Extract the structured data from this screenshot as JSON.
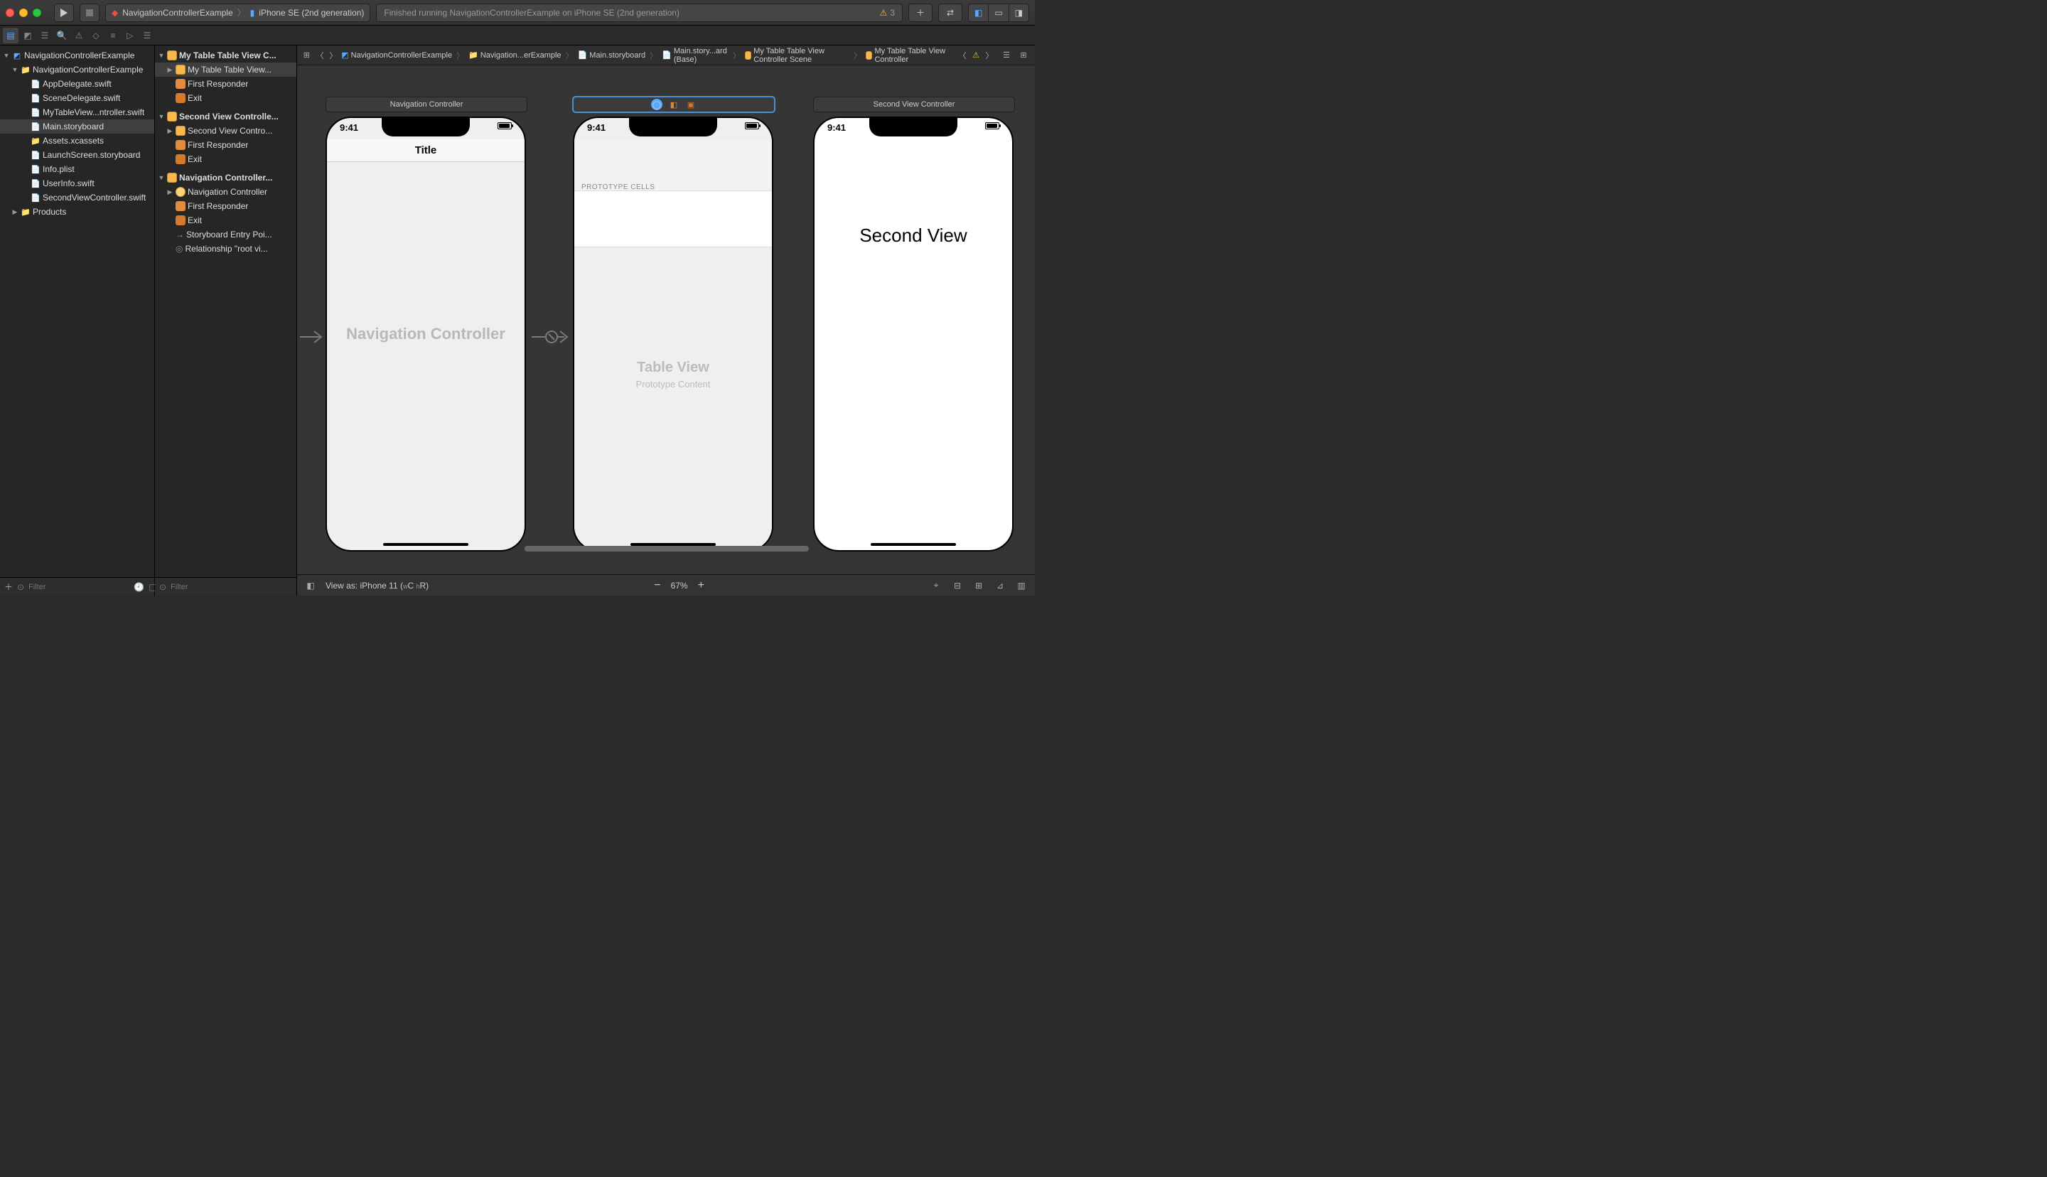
{
  "toolbar": {
    "scheme_project": "NavigationControllerExample",
    "scheme_device": "iPhone SE (2nd generation)",
    "status_text": "Finished running NavigationControllerExample on iPhone SE (2nd generation)",
    "warning_count": "3"
  },
  "jumpbar": {
    "crumbs": [
      "NavigationControllerExample",
      "Navigation...erExample",
      "Main.storyboard",
      "Main.story...ard (Base)",
      "My Table Table View Controller Scene",
      "My Table Table View Controller"
    ]
  },
  "project_nav": {
    "root": "NavigationControllerExample",
    "group": "NavigationControllerExample",
    "files": [
      "AppDelegate.swift",
      "SceneDelegate.swift",
      "MyTableView...ntroller.swift",
      "Main.storyboard",
      "Assets.xcassets",
      "LaunchScreen.storyboard",
      "Info.plist",
      "UserInfo.swift",
      "SecondViewController.swift"
    ],
    "products": "Products",
    "filter_placeholder": "Filter"
  },
  "doc_outline": {
    "scene1": {
      "title": "My Table Table View C...",
      "vc": "My Table Table View...",
      "first_responder": "First Responder",
      "exit": "Exit"
    },
    "scene2": {
      "title": "Second View Controlle...",
      "vc": "Second View Contro...",
      "first_responder": "First Responder",
      "exit": "Exit"
    },
    "scene3": {
      "title": "Navigation Controller...",
      "vc": "Navigation Controller",
      "first_responder": "First Responder",
      "exit": "Exit",
      "entry": "Storyboard Entry Poi...",
      "relationship": "Relationship \"root vi..."
    },
    "filter_placeholder": "Filter"
  },
  "canvas": {
    "scene_labels": {
      "nav": "Navigation Controller",
      "second": "Second View Controller"
    },
    "time": "9:41",
    "nav_title": "Title",
    "nav_body": "Navigation Controller",
    "tv_header": "PROTOTYPE CELLS",
    "tv_body_title": "Table View",
    "tv_body_sub": "Prototype Content",
    "second_body": "Second View"
  },
  "bottom_bar": {
    "view_as": "View as: iPhone 11 (",
    "wC": "C",
    "hR": "R)",
    "zoom": "67%"
  }
}
